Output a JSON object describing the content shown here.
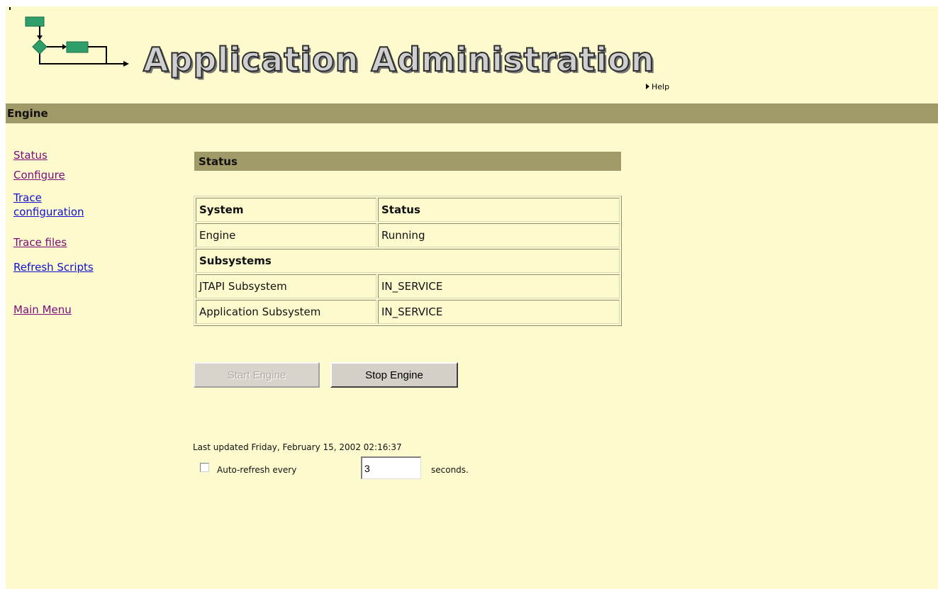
{
  "header": {
    "title": "Application Administration",
    "help_label": "Help"
  },
  "section": {
    "title": "Engine"
  },
  "nav": {
    "status": "Status",
    "configure": "Configure",
    "trace_config_line1": "Trace",
    "trace_config_line2": "configuration",
    "trace_files": "Trace files",
    "refresh_scripts": "Refresh Scripts",
    "main_menu": "Main Menu"
  },
  "panel": {
    "title": "Status"
  },
  "status_table": {
    "header_system": "System",
    "header_status": "Status",
    "rows": [
      {
        "system": "Engine",
        "status": "Running"
      }
    ],
    "subsystems_label": "Subsystems",
    "subsystems": [
      {
        "system": "JTAPI Subsystem",
        "status": "IN_SERVICE"
      },
      {
        "system": "Application Subsystem",
        "status": "IN_SERVICE"
      }
    ]
  },
  "buttons": {
    "start_engine": "Start Engine",
    "stop_engine": "Stop Engine"
  },
  "footer": {
    "last_updated": "Last updated Friday, February 15, 2002 02:16:37",
    "auto_refresh_label": "Auto-refresh every",
    "auto_refresh_value": "3",
    "seconds_label": "seconds."
  },
  "colors": {
    "page_background": "#fdfbcd",
    "bar_background": "#a09a69",
    "visited_link": "#7a0a7a",
    "link": "#1010d0",
    "logo_green": "#2e9e6a"
  },
  "icons": {
    "logo": "workflow-diagram-icon",
    "help": "triangle-right-icon",
    "checkbox": "checkbox-unchecked"
  }
}
